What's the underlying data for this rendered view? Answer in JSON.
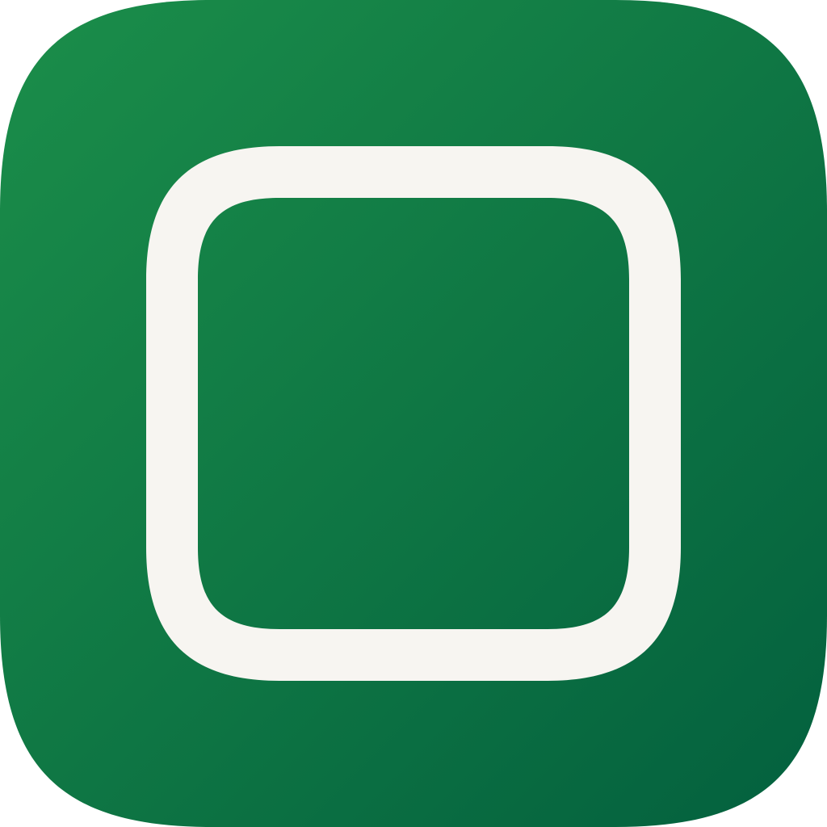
{
  "app_icon": {
    "icon": "rounded-square-outline-icon",
    "colors": {
      "background_gradient_start": "#1B8E4A",
      "background_gradient_end": "#03603E",
      "foreground": "#F7F5F1"
    }
  }
}
